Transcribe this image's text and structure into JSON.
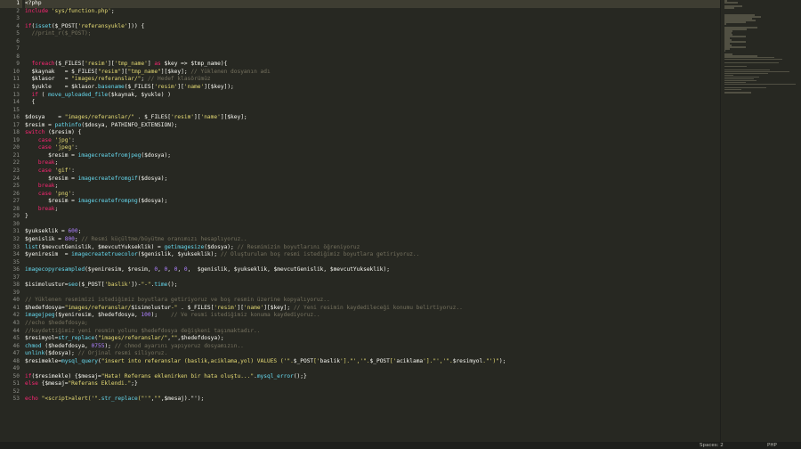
{
  "status": {
    "position": "Spaces: 2",
    "syntax": "PHP"
  },
  "active_line": 1,
  "lines": [
    "<?php",
    "include 'sys/function.php';",
    "",
    "if(isset($_POST['referansyukle'])) {",
    "  //print_r($_POST);",
    "",
    "",
    "",
    "  foreach($_FILES['resim']['tmp_name'] as $key => $tmp_name){",
    "  $kaynak   = $_FILES[\"resim\"][\"tmp_name\"][$key]; // Yüklenen dosyanın adı",
    "  $klasor   = \"images/referanslar/\"; // Hedef klasörümüz",
    "  $yukle    = $klasor.basename($_FILES['resim']['name'][$key]);",
    "  if ( move_uploaded_file($kaynak, $yukle) )",
    "  {",
    "",
    "$dosya    = \"images/referanslar/\" . $_FILES['resim']['name'][$key];",
    "$resim = pathinfo($dosya, PATHINFO_EXTENSION);",
    "switch ($resim) {",
    "    case 'jpg':",
    "    case 'jpeg':",
    "       $resim = imagecreatefromjpeg($dosya);",
    "    break;",
    "    case 'gif':",
    "       $resim = imagecreatefromgif($dosya);",
    "    break;",
    "    case 'png':",
    "       $resim = imagecreatefrompng($dosya);",
    "    break;",
    "}",
    "",
    "$yukseklik = 600;",
    "$genislik = 800; // Resmi küçültme/büyütme oranımızı hesaplıyoruz..",
    "list($mevcutGenislik, $mevcutYukseklik) = getimagesize($dosya); // Resmimizin boyutlarını öğreniyoruz",
    "$yeniresim  = imagecreatetruecolor($genislik, $yukseklik); // Oluşturulan boş resmi istediğimiz boyutlara getiriyoruz..",
    "",
    "imagecopyresampled($yeniresim, $resim, 0, 0, 0, 0,  $genislik, $yukseklik, $mevcutGenislik, $mevcutYukseklik);",
    "",
    "$isimolustur=seo($_POST['baslik'])-\"-\".time();",
    "",
    "// Yüklenen resmimizi istediğimiz boyutlara getiriyoruz ve boş resmin üzerine kopyalıyoruz..",
    "$hedefdosya=\"images/referanslar/$isimolustur-\" . $_FILES['resim']['name'][$key]; // Yeni resimin kaydedileceği konumu belirtiyoruz..",
    "imagejpeg($yeniresim, $hedefdosya, 100);    // Ve resmi istediğimiz konuma kaydediyoruz..",
    "//echo $hedefdosya;",
    "//kaydettiğimiz yeni resmin yolunu $hedefdosya değişkeni taşımaktadır..",
    "$resimyol=str_replace(\"images/referanslar/\",\"\",$hedefdosya);",
    "chmod ($hedefdosya, 0755); // chmod ayarını yapıyoruz dosyamızın..",
    "unlink($dosya); // Orjinal resmi siliyoruz.",
    "$resimekle=mysql_query(\"insert into referanslar (baslik,aciklama,yol) VALUES ('\".$_POST['baslik'].\"','\".$_POST['aciklama'].\"','\".$resimyol.\"')\");",
    "",
    "if($resimekle) {$mesaj=\"Hata! Referans eklenirken bir hata oluştu...\".mysql_error();}",
    "else {$mesaj=\"Referans Eklendi.\";}",
    "",
    "echo \"<script>alert('\".str_replace(\"'\",\"\",$mesaj).\"');"
  ]
}
